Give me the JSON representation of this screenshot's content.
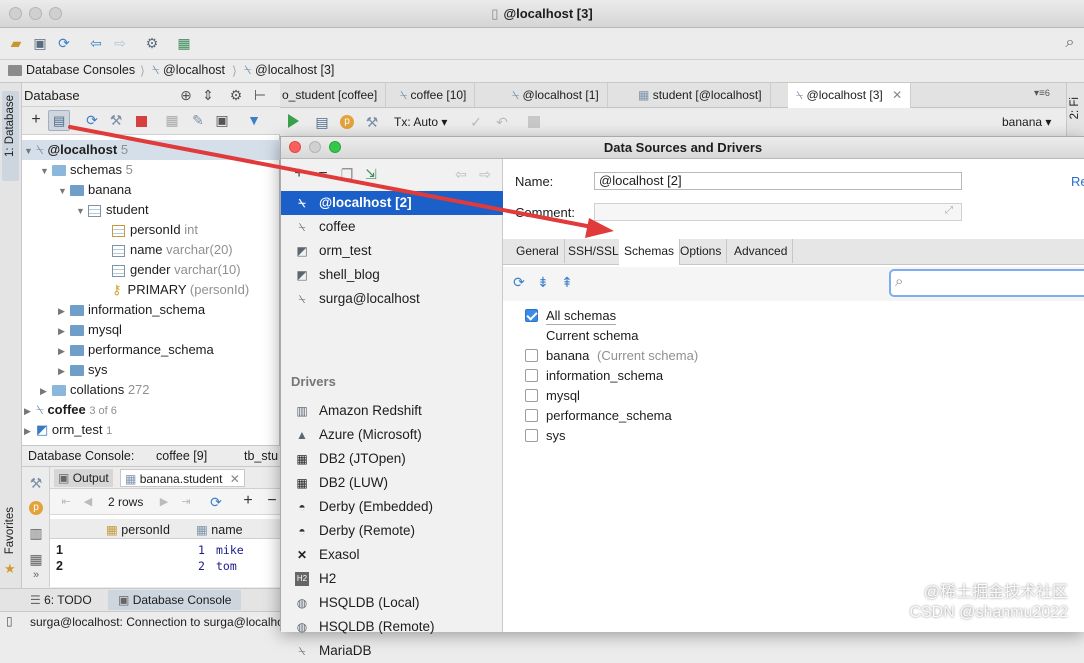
{
  "window": {
    "title": "@localhost [3]"
  },
  "navbar": {
    "crumbs": [
      "Database Consoles",
      "@localhost",
      "@localhost [3]"
    ]
  },
  "side_tabs": {
    "database": "1: Database",
    "favorites": "Favorites",
    "structure": "2: Fi"
  },
  "db_panel": {
    "title": "Database",
    "tree": [
      {
        "label": "@localhost",
        "count": "5"
      },
      {
        "label": "schemas",
        "count": "5"
      },
      {
        "label": "banana"
      },
      {
        "label": "student"
      },
      {
        "label": "personId",
        "type": "int"
      },
      {
        "label": "name",
        "type": "varchar(20)"
      },
      {
        "label": "gender",
        "type": "varchar(10)"
      },
      {
        "label": "PRIMARY",
        "type": "(personId)"
      },
      {
        "label": "information_schema"
      },
      {
        "label": "mysql"
      },
      {
        "label": "performance_schema"
      },
      {
        "label": "sys"
      },
      {
        "label": "collations",
        "count": "272"
      },
      {
        "label": "coffee",
        "count": "3 of 6"
      },
      {
        "label": "orm_test",
        "count": "1"
      }
    ]
  },
  "console_bar": {
    "label": "Database Console:",
    "tabs": [
      "coffee [9]",
      "tb_stu"
    ]
  },
  "output": {
    "tabs": [
      "Output",
      "banana.student"
    ],
    "rows_label": "2 rows",
    "columns": [
      "personId",
      "name"
    ],
    "rows": [
      {
        "num": "1",
        "personId": "1",
        "name": "mike"
      },
      {
        "num": "2",
        "personId": "2",
        "name": "tom"
      }
    ]
  },
  "bottom_tabs": {
    "todo": "6: TODO",
    "console": "Database Console"
  },
  "status": {
    "text": "surga@localhost: Connection to surga@localhost"
  },
  "editor_tabs": [
    "o_student [coffee]",
    "coffee [10]",
    "@localhost [1]",
    "student [@localhost]",
    "@localhost [3]"
  ],
  "editor_tabs_more": "6",
  "editor_toolbar": {
    "tx": "Tx: Auto",
    "schema": "banana"
  },
  "dialog": {
    "title": "Data Sources and Drivers",
    "datasources": [
      "@localhost [2]",
      "coffee",
      "orm_test",
      "shell_blog",
      "surga@localhost"
    ],
    "drivers_header": "Drivers",
    "drivers": [
      "Amazon Redshift",
      "Azure (Microsoft)",
      "DB2 (JTOpen)",
      "DB2 (LUW)",
      "Derby (Embedded)",
      "Derby (Remote)",
      "Exasol",
      "H2",
      "HSQLDB (Local)",
      "HSQLDB (Remote)",
      "MariaDB"
    ],
    "name_label": "Name:",
    "name_value": "@localhost [2]",
    "comment_label": "Comment:",
    "comment_value": "",
    "right_cut": "Re",
    "tabs": [
      "General",
      "SSH/SSL",
      "Schemas",
      "Options",
      "Advanced"
    ],
    "search_placeholder": "",
    "schemas": [
      {
        "label": "All schemas",
        "checked": true,
        "note": ""
      },
      {
        "label": "Current schema",
        "checked": false,
        "note": ""
      },
      {
        "label": "banana",
        "checked": false,
        "note": "(Current schema)"
      },
      {
        "label": "information_schema",
        "checked": false,
        "note": ""
      },
      {
        "label": "mysql",
        "checked": false,
        "note": ""
      },
      {
        "label": "performance_schema",
        "checked": false,
        "note": ""
      },
      {
        "label": "sys",
        "checked": false,
        "note": ""
      }
    ]
  },
  "watermark": {
    "line1": "@稀土掘金技术社区",
    "line2": "CSDN @shanmu2022"
  },
  "colors": {
    "selection": "#1b60c8",
    "annotation_arrow": "#e03a3a",
    "accent": "#3a8ce6"
  }
}
